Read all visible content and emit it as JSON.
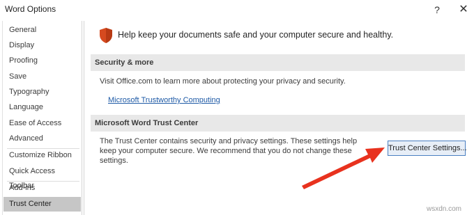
{
  "window": {
    "title": "Word Options",
    "help_label": "?",
    "close_label": "✕"
  },
  "sidebar": {
    "items": [
      {
        "label": "General"
      },
      {
        "label": "Display"
      },
      {
        "label": "Proofing"
      },
      {
        "label": "Save"
      },
      {
        "label": "Typography"
      },
      {
        "label": "Language"
      },
      {
        "label": "Ease of Access"
      },
      {
        "label": "Advanced"
      },
      {
        "label": "Customize Ribbon"
      },
      {
        "label": "Quick Access Toolbar"
      },
      {
        "label": "Add-ins"
      },
      {
        "label": "Trust Center"
      }
    ],
    "selected": "Trust Center"
  },
  "main": {
    "intro": "Help keep your documents safe and your computer secure and healthy.",
    "security_section": {
      "header": "Security & more",
      "text": "Visit Office.com to learn more about protecting your privacy and security.",
      "link": "Microsoft Trustworthy Computing"
    },
    "trust_center_section": {
      "header": "Microsoft Word Trust Center",
      "description": "The Trust Center contains security and privacy settings. These settings help keep your computer secure. We recommend that you do not change these settings.",
      "button_label": "Trust Center Settings..."
    }
  },
  "watermark": "wsxdn.com",
  "colors": {
    "shield": "#d64a1f",
    "arrow": "#e8321e",
    "link": "#1e5aa6",
    "selected_nav": "#c6c6c6",
    "section_header_bg": "#e8e8e8"
  }
}
